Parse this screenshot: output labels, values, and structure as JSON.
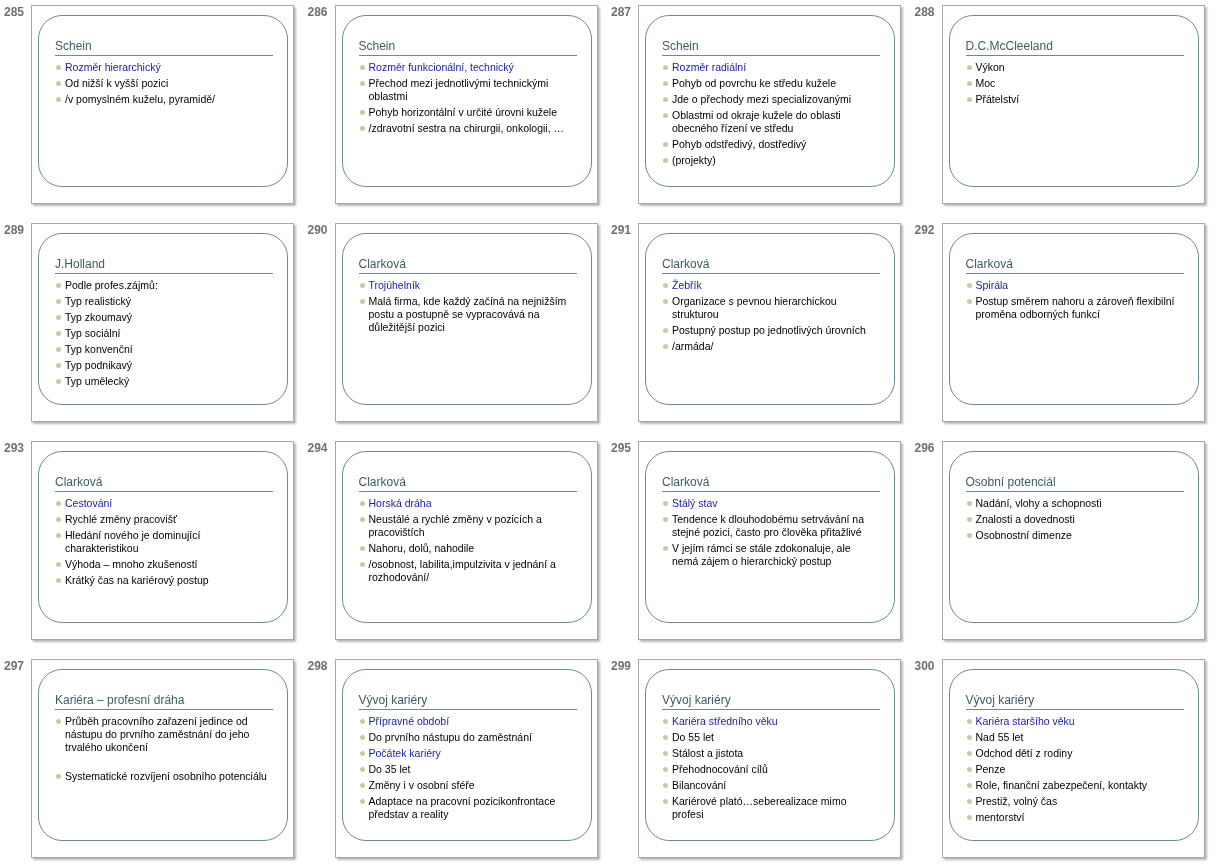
{
  "slides": [
    {
      "number": "285",
      "title": "Schein",
      "items": [
        {
          "kind": "accent",
          "text": "Rozměr hierarchický"
        },
        {
          "kind": "plain",
          "text": "Od nižší k vyšší pozici"
        },
        {
          "kind": "plain",
          "text": "/v pomyslném kuželu, pyramidě/"
        }
      ]
    },
    {
      "number": "286",
      "title": "Schein",
      "items": [
        {
          "kind": "accent",
          "text": "Rozměr funkcionální, technický"
        },
        {
          "kind": "plain",
          "text": "Přechod mezi jednotlivými technickými oblastmi"
        },
        {
          "kind": "plain",
          "text": "Pohyb horizontální v určité úrovni kužele"
        },
        {
          "kind": "plain",
          "text": "/zdravotní sestra na chirurgii, onkologii, …"
        }
      ]
    },
    {
      "number": "287",
      "title": "Schein",
      "items": [
        {
          "kind": "accent",
          "text": "Rozměr radiální"
        },
        {
          "kind": "plain",
          "text": "Pohyb od povrchu ke středu kužele"
        },
        {
          "kind": "plain",
          "text": "Jde o přechody mezi specializovanými"
        },
        {
          "kind": "plain",
          "text": "Oblastmi od okraje kužele do oblasti obecného řízení ve středu"
        },
        {
          "kind": "plain",
          "text": "Pohyb odstředivý, dostředivý"
        },
        {
          "kind": "plain",
          "text": "(projekty)"
        }
      ]
    },
    {
      "number": "288",
      "title": "D.C.McCleeland",
      "items": [
        {
          "kind": "plain",
          "text": "Výkon"
        },
        {
          "kind": "plain",
          "text": "Moc"
        },
        {
          "kind": "plain",
          "text": "Přátelství"
        }
      ]
    },
    {
      "number": "289",
      "title": "J.Holland",
      "items": [
        {
          "kind": "plain",
          "text": "Podle profes.zájmů:"
        },
        {
          "kind": "plain",
          "text": "Typ realistický"
        },
        {
          "kind": "plain",
          "text": "Typ zkoumavý"
        },
        {
          "kind": "plain",
          "text": "Typ sociální"
        },
        {
          "kind": "plain",
          "text": "Typ konvenční"
        },
        {
          "kind": "plain",
          "text": "Typ podnikavý"
        },
        {
          "kind": "plain",
          "text": "Typ umělecký"
        }
      ]
    },
    {
      "number": "290",
      "title": "Clarková",
      "items": [
        {
          "kind": "accent",
          "text": "Trojúhelník"
        },
        {
          "kind": "plain",
          "text": "Malá firma, kde každý začíná na nejnižším postu a postupně se vypracovává na důležitější pozici"
        }
      ]
    },
    {
      "number": "291",
      "title": "Clarková",
      "items": [
        {
          "kind": "accent",
          "text": "Žebřík"
        },
        {
          "kind": "plain",
          "text": "Organizace s pevnou hierarchickou strukturou"
        },
        {
          "kind": "plain",
          "text": "Postupný postup po jednotlivých úrovních"
        },
        {
          "kind": "plain",
          "text": "/armáda/"
        }
      ]
    },
    {
      "number": "292",
      "title": "Clarková",
      "items": [
        {
          "kind": "accent",
          "text": "Spirála"
        },
        {
          "kind": "plain",
          "text": "Postup směrem nahoru a zároveň flexibilní proměna odborných funkcí"
        }
      ]
    },
    {
      "number": "293",
      "title": "Clarková",
      "items": [
        {
          "kind": "accent",
          "text": "Cestování"
        },
        {
          "kind": "plain",
          "text": "Rychlé změny pracovišť"
        },
        {
          "kind": "plain",
          "text": "Hledání nového je dominující charakteristikou"
        },
        {
          "kind": "plain",
          "text": "Výhoda – mnoho zkušeností"
        },
        {
          "kind": "plain",
          "text": "Krátký čas na kariérový postup"
        }
      ]
    },
    {
      "number": "294",
      "title": "Clarková",
      "items": [
        {
          "kind": "accent",
          "text": "Horská dráha"
        },
        {
          "kind": "plain",
          "text": "Neustálé a rychlé změny v pozicích a pracovištích"
        },
        {
          "kind": "plain",
          "text": "Nahoru, dolů, nahodile"
        },
        {
          "kind": "plain",
          "text": "/osobnost, labilita,impulzivita v jednání  a rozhodování/"
        }
      ]
    },
    {
      "number": "295",
      "title": "Clarková",
      "items": [
        {
          "kind": "accent",
          "text": "Stálý stav"
        },
        {
          "kind": "plain",
          "text": "Tendence k dlouhodobému setrvávání na stejné pozici, často pro člověka přitažlivé"
        },
        {
          "kind": "plain",
          "text": "V jejím rámci se stále zdokonaluje, ale nemá zájem o hierarchický postup"
        }
      ]
    },
    {
      "number": "296",
      "title": "Osobní potenciál",
      "items": [
        {
          "kind": "plain",
          "text": "Nadání, vlohy a schopnosti"
        },
        {
          "kind": "plain",
          "text": "Znalosti a dovednosti"
        },
        {
          "kind": "plain",
          "text": "Osobnostní dimenze"
        }
      ]
    },
    {
      "number": "297",
      "title": "Kariéra – profesní dráha",
      "items": [
        {
          "kind": "plain",
          "text": "Průběh pracovního zařazení jedince od nástupu do prvního zaměstnání do jeho trvalého ukončení"
        },
        {
          "kind": "spaced",
          "text": "Systematické rozvíjení osobního potenciálu"
        }
      ]
    },
    {
      "number": "298",
      "title": "Vývoj kariéry",
      "items": [
        {
          "kind": "accent",
          "text": "Přípravné období"
        },
        {
          "kind": "plain",
          "text": "Do prvního nástupu do zaměstnání"
        },
        {
          "kind": "accent",
          "text": "Počátek kariéry"
        },
        {
          "kind": "plain",
          "text": "Do 35 let"
        },
        {
          "kind": "plain",
          "text": "Změny i v osobní sféře"
        },
        {
          "kind": "plain",
          "text": "Adaptace na pracovní pozicikonfrontace představ a reality"
        }
      ]
    },
    {
      "number": "299",
      "title": "Vývoj kariéry",
      "items": [
        {
          "kind": "accent",
          "text": "Kariéra středního věku"
        },
        {
          "kind": "plain",
          "text": "Do 55 let"
        },
        {
          "kind": "plain",
          "text": "Stálost a jistota"
        },
        {
          "kind": "plain",
          "text": "Přehodnocování cílů"
        },
        {
          "kind": "plain",
          "text": "Bilancování"
        },
        {
          "kind": "plain",
          "text": "Kariérové plató…seberealizace mimo profesi"
        }
      ]
    },
    {
      "number": "300",
      "title": "Vývoj kariéry",
      "items": [
        {
          "kind": "accent",
          "text": "Kariéra staršího věku"
        },
        {
          "kind": "plain",
          "text": "Nad 55 let"
        },
        {
          "kind": "plain",
          "text": "Odchod dětí z rodiny"
        },
        {
          "kind": "plain",
          "text": "Penze"
        },
        {
          "kind": "plain",
          "text": "Role, finanční zabezpečení, kontakty"
        },
        {
          "kind": "plain",
          "text": "Prestiž, volný čas"
        },
        {
          "kind": "plain",
          "text": "mentorství"
        }
      ]
    }
  ]
}
